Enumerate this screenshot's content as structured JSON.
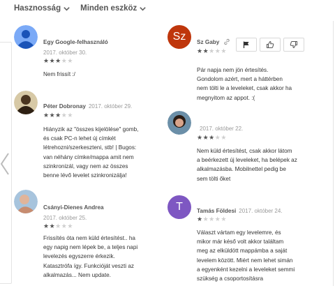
{
  "filters": {
    "sort": "Hasznosság",
    "device": "Minden eszköz"
  },
  "reviews": [
    {
      "name": "Egy Google-felhasználó",
      "date": "2017. október 30.",
      "rating": 3,
      "text": [
        "Nem frissít :/"
      ],
      "avatar_color": "#7baaf7"
    },
    {
      "name": "Sz Gaby",
      "date": "",
      "rating": 2,
      "avatar_initials": "Sz",
      "avatar_color": "#bf360c",
      "text": [
        "Pár napja nem jön értesítés.",
        "Gondolom azért, mert a háttérben",
        "nem tölti le a leveleket, csak akkor ha",
        "megnyitom az appot. :("
      ]
    },
    {
      "name": "Péter Dobronay",
      "date": "2017. október 29.",
      "rating": 3,
      "avatar_color": "#5d4a2e",
      "text": [
        "Hiányzik az \"összes kijelölése\" gomb,",
        "és csak PC-n lehet új címkét",
        "létrehozni/szerkeszteni, stb! | Bugos:",
        "van néhány címke/mappa amit nem",
        "szinkronizál, vagy nem az összes",
        "benne lévő levelet szinkronizálja!"
      ]
    },
    {
      "name": "",
      "date": "2017. október 22.",
      "rating": 3,
      "avatar_color": "#6d4c41",
      "text": [
        "Nem küld értesítést, csak akkor látom",
        "a beérkezett új leveleket, ha belépek az",
        "alkalmazásba. Mobilnettel pedig be",
        "sem tölti őket"
      ]
    },
    {
      "name": "Csányi-Dienes Andrea",
      "date": "2017. október 25.",
      "rating": 2,
      "avatar_color": "#c9a58a",
      "text": [
        "Frissítés óta nem küld értesítést.. ha",
        "egy napig nem lépek be, a teljes napi",
        "levelezés egyszerre érkezik.",
        "Katasztrófa így. Funkcióját veszti az",
        "alkalmazás... Nem update."
      ]
    },
    {
      "name": "Tamás Földesi",
      "date": "2017. október 24.",
      "rating": 1,
      "avatar_initials": "T",
      "avatar_color": "#7e57c2",
      "text": [
        "Választ vártam egy levelemre, és",
        "mikor már késő volt akkor találtam",
        "meg az elküldött mappámba a saját",
        "levelem között. Miért nem lehet simán",
        "a egyenként kezelni a leveleket semmi",
        "szükség a csoportosításra"
      ]
    }
  ],
  "icons": {
    "sort_chevron": "chevron-down-icon",
    "prev": "chevron-left-icon",
    "flag": "flag-icon",
    "thumb_up": "thumb-up-icon",
    "thumb_down": "thumb-down-icon",
    "link": "link-icon"
  }
}
